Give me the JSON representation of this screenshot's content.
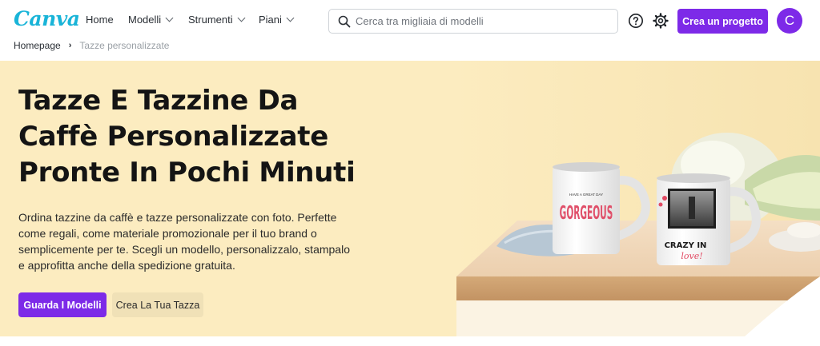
{
  "header": {
    "logo": "Canva",
    "nav": [
      {
        "label": "Home",
        "has_dropdown": false
      },
      {
        "label": "Modelli",
        "has_dropdown": true
      },
      {
        "label": "Strumenti",
        "has_dropdown": true
      },
      {
        "label": "Piani",
        "has_dropdown": true
      }
    ],
    "search": {
      "placeholder": "Cerca tra migliaia di modelli",
      "value": "",
      "icon": "search-icon"
    },
    "help_icon": "help-icon",
    "settings_icon": "gear-icon",
    "create_button": "Crea un progetto",
    "avatar_initial": "C",
    "accent_color": "#7d2ae8"
  },
  "breadcrumb": {
    "items": [
      "Homepage",
      "Tazze personalizzate"
    ],
    "separator": "›"
  },
  "hero": {
    "title": "Tazze E Tazzine Da Caffè Personalizzate Pronte In Pochi Minuti",
    "description": "Ordina tazzine da caffè e tazze personalizzate con foto. Perfette come regali, come materiale promozionale per il tuo brand o semplicemente per te. Scegli un modello, personalizzalo, stampalo e approfitta anche della spedizione gratuita.",
    "primary_button": "Guarda I Modelli",
    "secondary_button": "Crea La Tua Tazza",
    "background_color": "#fcecc0",
    "image": {
      "mug1_small_text": "HAVE A GREAT DAY",
      "mug1_big_text": "GORGEOUS",
      "mug2_text": "CRAZY IN",
      "mug2_script": "love!"
    }
  }
}
